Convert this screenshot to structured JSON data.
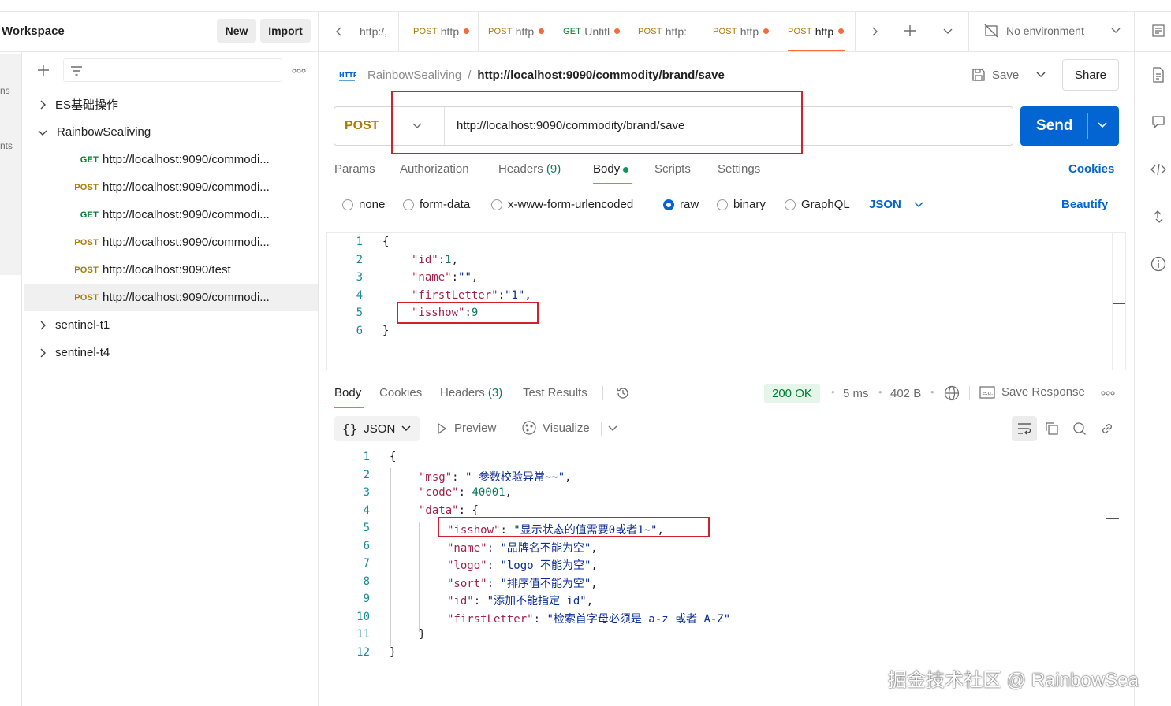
{
  "workspace": {
    "title": "Workspace",
    "new_label": "New",
    "import_label": "Import"
  },
  "left_strip": {
    "frag1": "ns",
    "frag2": "nts"
  },
  "collections": [
    {
      "name": "ES基础操作",
      "expanded": false
    },
    {
      "name": "RainbowSealiving",
      "expanded": true
    },
    {
      "name": "sentinel-t1",
      "expanded": false
    },
    {
      "name": "sentinel-t4",
      "expanded": false
    }
  ],
  "requests": [
    {
      "method": "GET",
      "url": "http://localhost:9090/commodi..."
    },
    {
      "method": "POST",
      "url": "http://localhost:9090/commodi..."
    },
    {
      "method": "GET",
      "url": "http://localhost:9090/commodi..."
    },
    {
      "method": "POST",
      "url": "http://localhost:9090/commodi..."
    },
    {
      "method": "POST",
      "url": "http://localhost:9090/test"
    },
    {
      "method": "POST",
      "url": "http://localhost:9090/commodi..."
    }
  ],
  "tabs": [
    {
      "method": "",
      "label": "http:/,"
    },
    {
      "method": "POST",
      "label": "http"
    },
    {
      "method": "POST",
      "label": "http"
    },
    {
      "method": "GET",
      "label": "Untitl"
    },
    {
      "method": "POST",
      "label": "http:"
    },
    {
      "method": "POST",
      "label": "http"
    },
    {
      "method": "POST",
      "label": "http"
    }
  ],
  "environment": {
    "label": "No environment"
  },
  "breadcrumb": {
    "icon_text": "HTTP",
    "collection": "RainbowSealiving",
    "separator": "/",
    "request": "http://localhost:9090/commodity/brand/save"
  },
  "actions": {
    "save": "Save",
    "share": "Share",
    "send": "Send"
  },
  "request": {
    "method": "POST",
    "url": "http://localhost:9090/commodity/brand/save"
  },
  "request_tabs": {
    "params": "Params",
    "authorization": "Authorization",
    "headers": "Headers",
    "headers_count": "(9)",
    "body": "Body",
    "scripts": "Scripts",
    "settings": "Settings",
    "cookies": "Cookies"
  },
  "body_types": {
    "none": "none",
    "form_data": "form-data",
    "urlencoded": "x-www-form-urlencoded",
    "raw": "raw",
    "binary": "binary",
    "graphql": "GraphQL",
    "format": "JSON",
    "beautify": "Beautify"
  },
  "request_body": {
    "line_numbers": [
      "1",
      "2",
      "3",
      "4",
      "5",
      "6"
    ],
    "open": "{",
    "k1": "\"id\"",
    "v1": "1",
    "k2": "\"name\"",
    "v2": "\"\"",
    "k3": "\"firstLetter\"",
    "v3": "\"1\"",
    "k4": "\"isshow\"",
    "v4": "9",
    "close": "}"
  },
  "response_tabs": {
    "body": "Body",
    "cookies": "Cookies",
    "headers": "Headers",
    "headers_count": "(3)",
    "test_results": "Test Results"
  },
  "response_meta": {
    "status": "200 OK",
    "time": "5 ms",
    "size": "402 B",
    "save_response": "Save Response",
    "eg": "e.g."
  },
  "response_view": {
    "format": "JSON",
    "preview": "Preview",
    "visualize": "Visualize"
  },
  "response_body": {
    "line_numbers": [
      "1",
      "2",
      "3",
      "4",
      "5",
      "6",
      "7",
      "8",
      "9",
      "10",
      "11",
      "12"
    ],
    "open": "{",
    "msg_key": "\"msg\"",
    "msg_val": "\" 参数校验异常~~\"",
    "code_key": "\"code\"",
    "code_val": "40001",
    "data_key": "\"data\"",
    "data_open": "{",
    "isshow_key": "\"isshow\"",
    "isshow_val": "\"显示状态的值需要0或者1~\"",
    "name_key": "\"name\"",
    "name_val": "\"品牌名不能为空\"",
    "logo_key": "\"logo\"",
    "logo_val": "\"logo 不能为空\"",
    "sort_key": "\"sort\"",
    "sort_val": "\"排序值不能为空\"",
    "id_key": "\"id\"",
    "id_val": "\"添加不能指定 id\"",
    "fl_key": "\"firstLetter\"",
    "fl_val": "\"检索首字母必须是 a-z 或者 A-Z\"",
    "data_close": "}",
    "close": "}"
  },
  "watermark": "掘金技术社区 @ RainbowSea",
  "colors": {
    "send": "#0265D2",
    "accent": "#FF6C37",
    "post": "#AD7A03",
    "get": "#007F31",
    "status_ok": "#007F31",
    "highlight_box": "#D2202F"
  }
}
